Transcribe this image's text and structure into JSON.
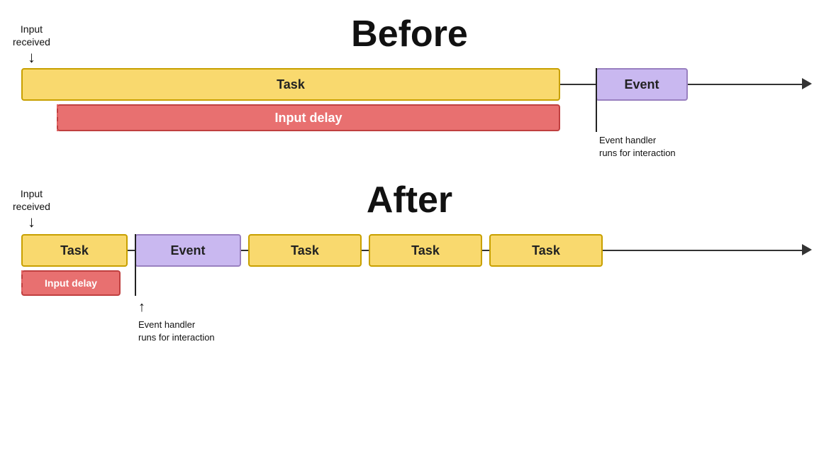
{
  "before": {
    "title": "Before",
    "input_received": "Input\nreceived",
    "task_label": "Task",
    "event_label": "Event",
    "input_delay_label": "Input delay",
    "event_handler_label": "Event handler\nruns for interaction"
  },
  "after": {
    "title": "After",
    "input_received": "Input\nreceived",
    "task_label": "Task",
    "event_label": "Event",
    "input_delay_label": "Input delay",
    "event_handler_label": "Event handler\nruns for interaction",
    "task2_label": "Task",
    "task3_label": "Task",
    "task4_label": "Task"
  }
}
